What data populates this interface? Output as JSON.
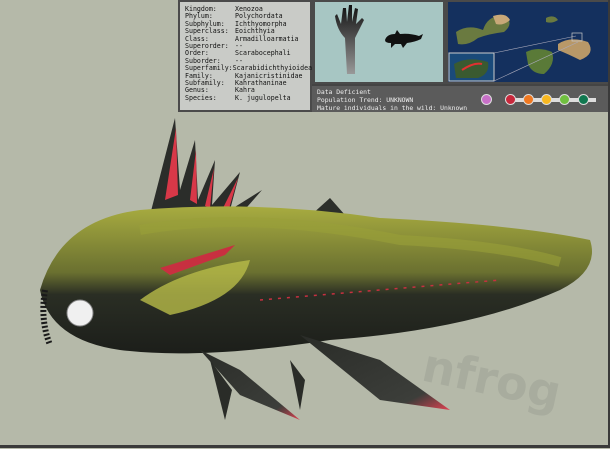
{
  "taxonomy": [
    {
      "rank": "Kingdom:",
      "value": "Xenozoa"
    },
    {
      "rank": "Phylum:",
      "value": "Polychordata"
    },
    {
      "rank": "Subphylum:",
      "value": "Ichthyomorpha"
    },
    {
      "rank": "Superclass:",
      "value": "Eoichthyia"
    },
    {
      "rank": "Class:",
      "value": "Armadilloarmatia"
    },
    {
      "rank": "Superorder:",
      "value": "--"
    },
    {
      "rank": "Order:",
      "value": "Scarabocephali"
    },
    {
      "rank": "Suborder:",
      "value": "--"
    },
    {
      "rank": "Superfamily:",
      "value": "Scarabidichthyioidea"
    },
    {
      "rank": "Family:",
      "value": "Kajanicristinidae"
    },
    {
      "rank": "Subfamily:",
      "value": "Kahrathaninae"
    },
    {
      "rank": "Genus:",
      "value": "Kahra"
    },
    {
      "rank": "Species:",
      "value": "K. jugulopelta"
    }
  ],
  "status": {
    "category": "Data Deficient",
    "trend_label": "Population Trend:",
    "trend_value": "UNKNOWN",
    "mature_label": "Mature individuals in the wild:",
    "mature_value": "Unknown",
    "colors": [
      "#c870c8",
      "#c8283c",
      "#f07820",
      "#f8b820",
      "#70c040",
      "#107850"
    ]
  },
  "watermark": "nfrog"
}
